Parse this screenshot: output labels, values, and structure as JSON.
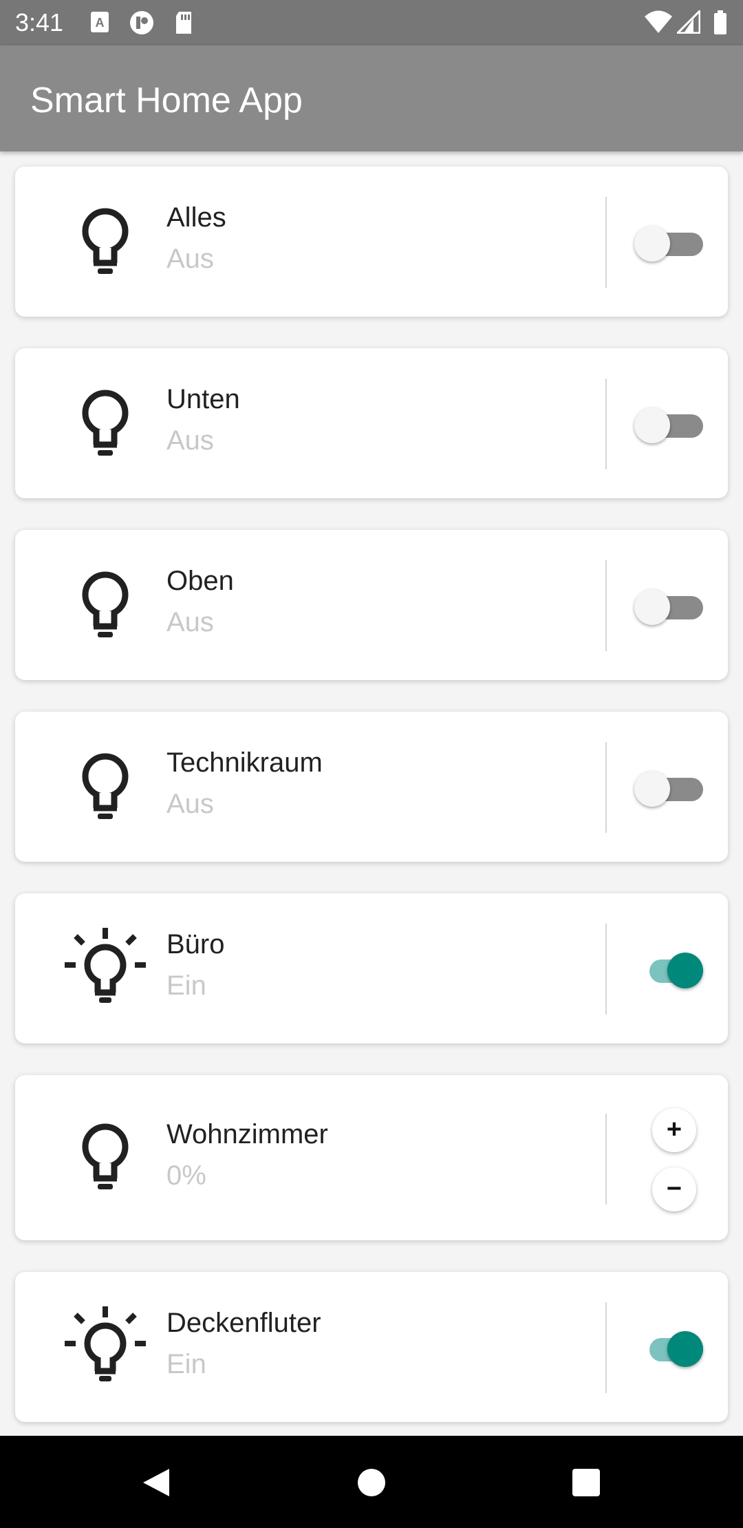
{
  "status_bar": {
    "time": "3:41",
    "icons": [
      "notification-a-icon",
      "podcast-icon",
      "sd-card-icon",
      "wifi-icon",
      "signal-icon",
      "battery-icon"
    ]
  },
  "app_bar": {
    "title": "Smart Home App"
  },
  "devices": [
    {
      "name": "Alles",
      "status": "Aus",
      "control": "switch",
      "on": false,
      "icon": "lightbulb-off-icon"
    },
    {
      "name": "Unten",
      "status": "Aus",
      "control": "switch",
      "on": false,
      "icon": "lightbulb-off-icon"
    },
    {
      "name": "Oben",
      "status": "Aus",
      "control": "switch",
      "on": false,
      "icon": "lightbulb-off-icon"
    },
    {
      "name": "Technikraum",
      "status": "Aus",
      "control": "switch",
      "on": false,
      "icon": "lightbulb-off-icon"
    },
    {
      "name": "Büro",
      "status": "Ein",
      "control": "switch",
      "on": true,
      "icon": "lightbulb-on-icon"
    },
    {
      "name": "Wohnzimmer",
      "status": "0%",
      "control": "dimmer",
      "increase_label": "+",
      "decrease_label": "−",
      "icon": "lightbulb-off-icon"
    },
    {
      "name": "Deckenfluter",
      "status": "Ein",
      "control": "switch",
      "on": true,
      "icon": "lightbulb-on-icon"
    }
  ],
  "colors": {
    "app_bar": "#8a8a8a",
    "status_bar": "#777777",
    "accent": "#00897b",
    "accent_track": "#7cc2bf",
    "switch_off_track": "#8a8a8a",
    "secondary_text": "#c8c8c8"
  },
  "nav_bar": {
    "icons": [
      "back-icon",
      "home-icon",
      "recents-icon"
    ]
  }
}
